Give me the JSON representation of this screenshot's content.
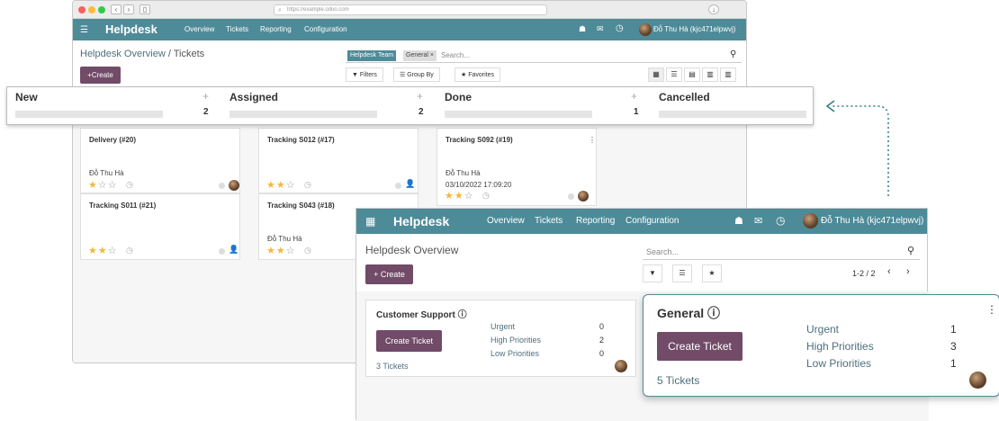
{
  "browser": {
    "url": "https://example.odoo.com"
  },
  "w1": {
    "brand": "Helpdesk",
    "menu": [
      "Overview",
      "Tickets",
      "Reporting",
      "Configuration"
    ],
    "user": "Đỗ Thu Hà (kjc471elpwvj)",
    "breadcrumb_parent": "Helpdesk Overview",
    "breadcrumb_sep": "/",
    "breadcrumb_current": "Tickets",
    "create": "Create",
    "facet_label": "Helpdesk Team",
    "facet_value": "General",
    "facet_close": "×",
    "search_placeholder": "Search...",
    "filters": "Filters",
    "groupby": "Group By",
    "favorites": "Favorites"
  },
  "kanban": {
    "columns": [
      {
        "name": "New",
        "count": "2"
      },
      {
        "name": "Assigned",
        "count": "2"
      },
      {
        "name": "Done",
        "count": "1"
      },
      {
        "name": "Cancelled",
        "count": ""
      }
    ],
    "plus": "+"
  },
  "cards": [
    {
      "title": "Delivery (#20)",
      "assignee": "Đỗ Thu Hà",
      "stars": 1
    },
    {
      "title": "Tracking S011 (#21)",
      "assignee": "",
      "stars": 2
    },
    {
      "title": "Tracking S012 (#17)",
      "assignee": "",
      "stars": 2
    },
    {
      "title": "Tracking S043 (#18)",
      "assignee": "Đỗ Thu Hà",
      "stars": 2
    },
    {
      "title": "Tracking S092 (#19)",
      "assignee": "Đỗ Thu Hà",
      "date": "03/10/2022 17:09:20",
      "stars": 2
    }
  ],
  "w2": {
    "brand": "Helpdesk",
    "menu": [
      "Overview",
      "Tickets",
      "Reporting",
      "Configuration"
    ],
    "user": "Đỗ Thu Hà (kjc471elpwvj)",
    "title": "Helpdesk Overview",
    "search_placeholder": "Search...",
    "create": "Create",
    "pager": "1-2 / 2",
    "customer_support": {
      "name": "Customer Support",
      "button": "Create Ticket",
      "tickets": "3 Tickets",
      "urgent_label": "Urgent",
      "urgent": "0",
      "high_label": "High Priorities",
      "high": "2",
      "low_label": "Low Priorities",
      "low": "0"
    },
    "general": {
      "name": "General",
      "button": "Create Ticket",
      "tickets": "5 Tickets",
      "urgent_label": "Urgent",
      "urgent": "1",
      "high_label": "High Priorities",
      "high": "3",
      "low_label": "Low Priorities",
      "low": "1"
    }
  },
  "colors": {
    "nav": "#4e8b98",
    "primary": "#714b67",
    "star": "#f3b83d"
  }
}
